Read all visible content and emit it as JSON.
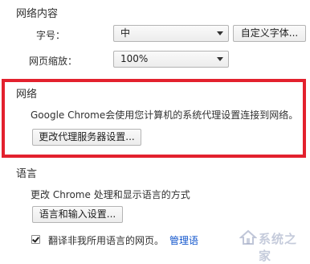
{
  "web_content": {
    "title": "网络内容",
    "font_size_label": "字号：",
    "font_size_value": "中",
    "custom_fonts_button": "自定义字体...",
    "page_zoom_label": "网页缩放：",
    "page_zoom_value": "100%"
  },
  "network": {
    "title": "网络",
    "description": "Google Chrome会使用您计算机的系统代理设置连接到网络。",
    "proxy_button": "更改代理服务器设置..."
  },
  "languages": {
    "title": "语言",
    "description": "更改 Chrome 处理和显示语言的方式",
    "language_button": "语言和输入设置...",
    "translate_checkbox_label": "翻译非我所用语言的网页。",
    "translate_checked": true,
    "manage_link": "管理语"
  },
  "watermark": {
    "text": "系统之家"
  },
  "colors": {
    "highlight_border": "#e3212e",
    "link": "#1155cc"
  }
}
